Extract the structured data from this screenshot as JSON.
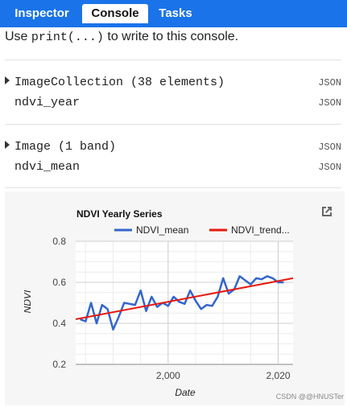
{
  "tabs": [
    {
      "label": "Inspector"
    },
    {
      "label": "Console"
    },
    {
      "label": "Tasks"
    }
  ],
  "console_hint": {
    "prefix": "Use ",
    "code": "print(...)",
    "suffix": " to write to this console."
  },
  "entries": [
    {
      "header": "ImageCollection (38 elements)",
      "name": "ndvi_year",
      "json_label": "JSON"
    },
    {
      "header": "Image (1 band)",
      "name": "ndvi_mean",
      "json_label": "JSON"
    }
  ],
  "chart_data": {
    "type": "line",
    "title": "NDVI Yearly Series",
    "xlabel": "Date",
    "ylabel": "NDVI",
    "xlim": [
      1983.2,
      2022.7
    ],
    "ylim": [
      0.2,
      0.8
    ],
    "x_ticks": [
      2000,
      2020
    ],
    "x_tick_labels": [
      "2,000",
      "2,020"
    ],
    "y_ticks": [
      0.2,
      0.4,
      0.6,
      0.8
    ],
    "y_tick_labels": [
      "0.2",
      "0.4",
      "0.6",
      "0.8"
    ],
    "grid": true,
    "legend_position": "top",
    "series": [
      {
        "name": "NDVI_mean",
        "color": "#3366cc",
        "x": [
          1984,
          1985,
          1986,
          1987,
          1988,
          1989,
          1990,
          1991,
          1992,
          1993,
          1994,
          1995,
          1996,
          1997,
          1998,
          1999,
          2000,
          2001,
          2002,
          2003,
          2004,
          2005,
          2006,
          2007,
          2008,
          2009,
          2010,
          2011,
          2012,
          2013,
          2014,
          2015,
          2016,
          2017,
          2018,
          2019,
          2020,
          2021
        ],
        "y": [
          0.42,
          0.41,
          0.5,
          0.4,
          0.49,
          0.47,
          0.37,
          0.43,
          0.5,
          0.495,
          0.49,
          0.56,
          0.46,
          0.53,
          0.48,
          0.5,
          0.485,
          0.53,
          0.505,
          0.495,
          0.56,
          0.51,
          0.47,
          0.49,
          0.485,
          0.53,
          0.62,
          0.545,
          0.565,
          0.63,
          0.61,
          0.59,
          0.62,
          0.615,
          0.63,
          0.62,
          0.6,
          0.6
        ]
      },
      {
        "name": "NDVI_trend...",
        "color": "#e8190c",
        "x": [
          1983.2,
          2022.7
        ],
        "y": [
          0.42,
          0.62
        ]
      }
    ]
  },
  "watermark": "CSDN @@HNUSTer"
}
